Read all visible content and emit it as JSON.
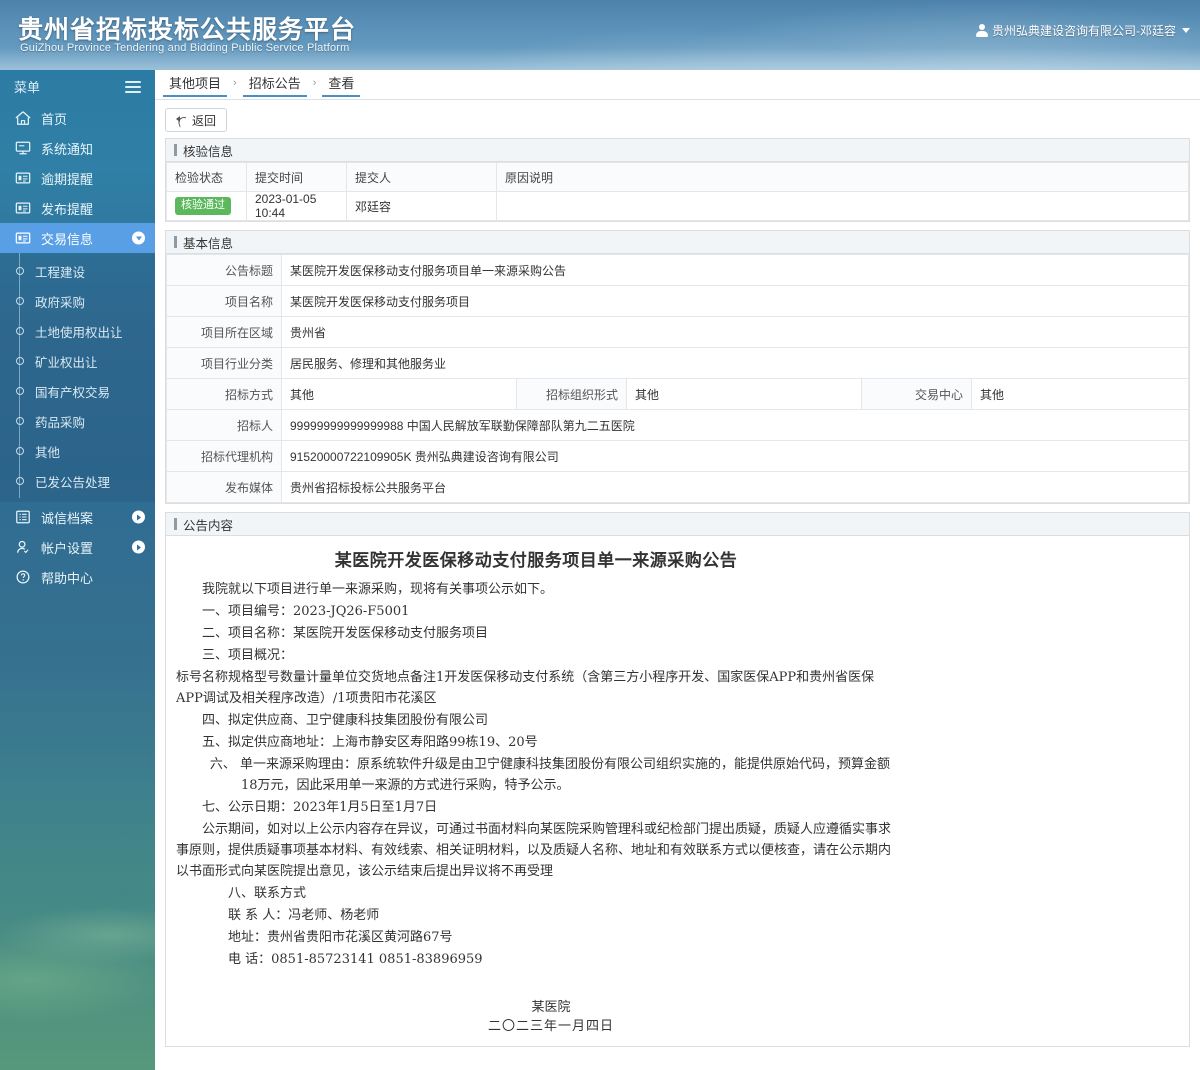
{
  "header": {
    "title_cn": "贵州省招标投标公共服务平台",
    "title_en": "GuiZhou Province Tendering and Bidding Public Service Platform",
    "user": "贵州弘典建设咨询有限公司-邓廷容"
  },
  "sidebar": {
    "menu_label": "菜单",
    "items": [
      {
        "label": "首页",
        "icon": "home-icon",
        "arrow": "none",
        "active": false
      },
      {
        "label": "系统通知",
        "icon": "monitor-icon",
        "arrow": "none",
        "active": false
      },
      {
        "label": "逾期提醒",
        "icon": "folder-list-icon",
        "arrow": "none",
        "active": false
      },
      {
        "label": "发布提醒",
        "icon": "folder-list-icon",
        "arrow": "none",
        "active": false
      },
      {
        "label": "交易信息",
        "icon": "folder-list-icon",
        "arrow": "down",
        "active": true
      }
    ],
    "sub_items": [
      {
        "label": "工程建设"
      },
      {
        "label": "政府采购"
      },
      {
        "label": "土地使用权出让"
      },
      {
        "label": "矿业权出让"
      },
      {
        "label": "国有产权交易"
      },
      {
        "label": "药品采购"
      },
      {
        "label": "其他"
      },
      {
        "label": "已发公告处理"
      }
    ],
    "bottom_items": [
      {
        "label": "诚信档案",
        "icon": "list-icon",
        "arrow": "right"
      },
      {
        "label": "帐户设置",
        "icon": "user-gear-icon",
        "arrow": "right"
      },
      {
        "label": "帮助中心",
        "icon": "question-icon",
        "arrow": "none"
      }
    ]
  },
  "breadcrumb": [
    "其他项目",
    "招标公告",
    "查看"
  ],
  "breadcrumb_sep": "›",
  "toolbar": {
    "back_label": "返回"
  },
  "verify_panel": {
    "title": "核验信息",
    "columns": [
      "检验状态",
      "提交时间",
      "提交人",
      "原因说明"
    ],
    "rows": [
      {
        "status": "核验通过",
        "time": "2023-01-05 10:44",
        "submitter": "邓廷容",
        "reason": ""
      }
    ]
  },
  "basic_panel": {
    "title": "基本信息",
    "fields": [
      {
        "label": "公告标题",
        "value": "某医院开发医保移动支付服务项目单一来源采购公告"
      },
      {
        "label": "项目名称",
        "value": "某医院开发医保移动支付服务项目"
      },
      {
        "label": "项目所在区域",
        "value": "贵州省"
      },
      {
        "label": "项目行业分类",
        "value": "居民服务、修理和其他服务业"
      }
    ],
    "triple_row": [
      {
        "label": "招标方式",
        "value": "其他"
      },
      {
        "label": "招标组织形式",
        "value": "其他"
      },
      {
        "label": "交易中心",
        "value": "其他"
      }
    ],
    "fields2": [
      {
        "label": "招标人",
        "value": "99999999999999988 中国人民解放军联勤保障部队第九二五医院"
      },
      {
        "label": "招标代理机构",
        "value": "91520000722109905K 贵州弘典建设咨询有限公司"
      },
      {
        "label": "发布媒体",
        "value": "贵州省招标投标公共服务平台"
      }
    ]
  },
  "content_panel": {
    "title": "公告内容",
    "doc_title": "某医院开发医保移动支付服务项目单一来源采购公告",
    "p_intro": "我院就以下项目进行单一来源采购，现将有关事项公示如下。",
    "p1": "一、项目编号：2023-JQ26-F5001",
    "p2": "二、项目名称：某医院开发医保移动支付服务项目",
    "p3": "三、项目概况：",
    "p_spec": "标号名称规格型号数量计量单位交货地点备注1开发医保移动支付系统（含第三方小程序开发、国家医保APP和贵州省医保APP调试及相关程序改造）/1项贵阳市花溪区",
    "p4": "四、拟定供应商、卫宁健康科技集团股份有限公司",
    "p5": "五、拟定供应商地址：上海市静安区寿阳路99栋19、20号",
    "p6": "六、 单一来源采购理由：原系统软件升级是由卫宁健康科技集团股份有限公司组织实施的，能提供原始代码，预算金额18万元，因此采用单一来源的方式进行采购，特予公示。",
    "p7": "七、公示日期：2023年1月5日至1月7日",
    "p_obj": "公示期间，如对以上公示内容存在异议，可通过书面材料向某医院采购管理科或纪检部门提出质疑，质疑人应遵循实事求事原则，提供质疑事项基本材料、有效线索、相关证明材料，以及质疑人名称、地址和有效联系方式以便核查，请在公示期内以书面形式向某医院提出意见，该公示结束后提出异议将不再受理",
    "p8": "八、联系方式",
    "p_contact": "联 系 人：冯老师、杨老师",
    "p_addr": "地址：贵州省贵阳市花溪区黄河路67号",
    "p_tel": "电      话：0851-85723141      0851-83896959",
    "sign_org": "某医院",
    "sign_date": "二〇二三年一月四日"
  },
  "colors": {
    "header_blue": "#5d93ba",
    "sidebar_top": "#2b7ba4",
    "active_blue": "#589fe6",
    "badge_green": "#5cb85c",
    "crumb_underline": "#4a90c4"
  }
}
